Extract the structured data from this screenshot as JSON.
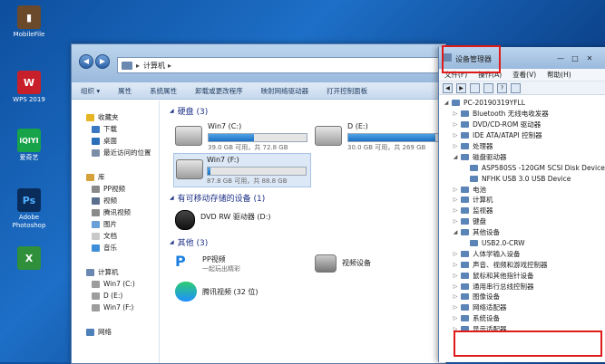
{
  "desktop": {
    "icons": [
      {
        "label": "MobileFile",
        "color": "#6b4a2c"
      },
      {
        "label": "WPS 2019",
        "color": "#c8202a"
      },
      {
        "label": "爱奇艺",
        "color": "#16a34a"
      },
      {
        "label": "Adobe Photoshop",
        "color": "#0a2c5a"
      },
      {
        "label": "",
        "color": "#2f8f3a"
      }
    ]
  },
  "explorer": {
    "address": "计算机",
    "toolbar": [
      "组织 ▾",
      "属性",
      "系统属性",
      "卸载或更改程序",
      "映射网络驱动器",
      "打开控制面板"
    ],
    "nav": {
      "favorites": [
        "收藏夹",
        "下载",
        "桌面",
        "最近访问的位置"
      ],
      "library": [
        "库",
        "PP视频",
        "视频",
        "腾讯视频",
        "图片",
        "文档",
        "音乐"
      ],
      "computer": [
        "计算机",
        "Win7 (C:)",
        "D (E:)",
        "Win7 (F:)"
      ],
      "network": [
        "网络"
      ]
    },
    "groups": {
      "hdd": "硬盘 (3)",
      "removable": "有可移动存储的设备 (1)",
      "other": "其他 (3)"
    },
    "drives": [
      {
        "name": "Win7 (C:)",
        "free": "39.0 GB 可用，共 72.8 GB",
        "fill": 0.46
      },
      {
        "name": "D (E:)",
        "free": "30.0 GB 可用，共 269 GB",
        "fill": 0.89
      },
      {
        "name": "Win7 (F:)",
        "free": "87.8 GB 可用，共 88.8 GB",
        "fill": 0.03
      }
    ],
    "dvd": "DVD RW 驱动器 (D:)",
    "other": [
      {
        "name": "PP视频",
        "sub": "一起玩出精彩"
      },
      {
        "name": "视频设备",
        "sub": ""
      },
      {
        "name": "腾讯视频 (32 位)",
        "sub": ""
      }
    ]
  },
  "devmgr": {
    "title": "设备管理器",
    "menu": [
      "文件(F)",
      "操作(A)",
      "查看(V)",
      "帮助(H)"
    ],
    "tree": [
      {
        "label": "PC-20190319YFLL",
        "level": 0,
        "ex": "◢"
      },
      {
        "label": "Bluetooth 无线电收发器",
        "level": 1,
        "ex": "▷"
      },
      {
        "label": "DVD/CD-ROM 驱动器",
        "level": 1,
        "ex": "▷"
      },
      {
        "label": "IDE ATA/ATAPI 控制器",
        "level": 1,
        "ex": "▷"
      },
      {
        "label": "处理器",
        "level": 1,
        "ex": "▷"
      },
      {
        "label": "磁盘驱动器",
        "level": 1,
        "ex": "◢"
      },
      {
        "label": "ASP580SS -120GM SCSI Disk Device",
        "level": 2,
        "ex": ""
      },
      {
        "label": "NFHK USB 3.0 USB Device",
        "level": 2,
        "ex": ""
      },
      {
        "label": "电池",
        "level": 1,
        "ex": "▷"
      },
      {
        "label": "计算机",
        "level": 1,
        "ex": "▷"
      },
      {
        "label": "监视器",
        "level": 1,
        "ex": "▷"
      },
      {
        "label": "键盘",
        "level": 1,
        "ex": "▷"
      },
      {
        "label": "其他设备",
        "level": 1,
        "ex": "◢"
      },
      {
        "label": "USB2.0-CRW",
        "level": 2,
        "ex": ""
      },
      {
        "label": "人体学输入设备",
        "level": 1,
        "ex": "▷"
      },
      {
        "label": "声音、视频和游戏控制器",
        "level": 1,
        "ex": "▷"
      },
      {
        "label": "鼠标和其他指针设备",
        "level": 1,
        "ex": "▷"
      },
      {
        "label": "通用串行总线控制器",
        "level": 1,
        "ex": "▷"
      },
      {
        "label": "图像设备",
        "level": 1,
        "ex": "▷"
      },
      {
        "label": "网络适配器",
        "level": 1,
        "ex": "▷"
      },
      {
        "label": "系统设备",
        "level": 1,
        "ex": "▷"
      },
      {
        "label": "显示适配器",
        "level": 1,
        "ex": "▷"
      }
    ]
  }
}
